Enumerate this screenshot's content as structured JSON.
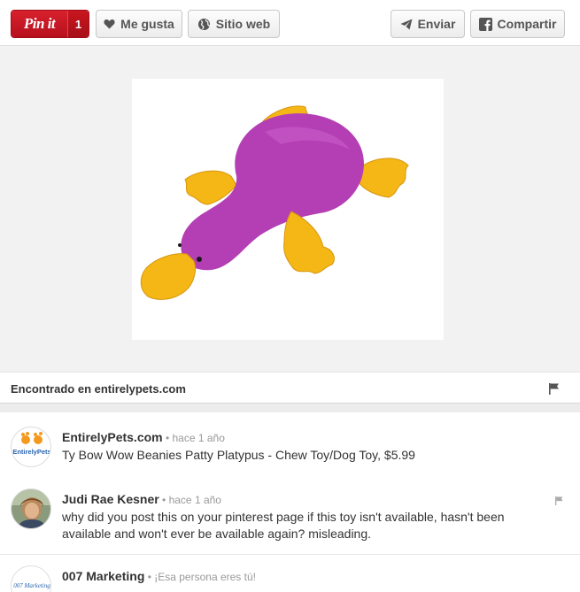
{
  "toolbar": {
    "pinit_label": "Pin it",
    "pin_count": "1",
    "like_label": "Me gusta",
    "website_label": "Sitio web",
    "send_label": "Enviar",
    "share_label": "Compartir"
  },
  "product": {
    "image_icon": "purple-platypus-plush-toy"
  },
  "found_on": {
    "text": "Encontrado en entirelypets.com"
  },
  "comments": [
    {
      "author": "EntirelyPets.com",
      "time": " • hace 1 año",
      "text": "Ty Bow Wow Beanies Patty Platypus - Chew Toy/Dog Toy, $5.99",
      "avatar_text": "EntirelyPets"
    },
    {
      "author": "Judi Rae Kesner",
      "time": " • hace 1 año",
      "text": "why did you post this on your pinterest page if this toy isn't available, hasn't been available and won't ever be available again? misleading."
    },
    {
      "author": "007 Marketing",
      "time": " • ¡Esa persona eres tú!",
      "text": "",
      "avatar_text": "007 Marketing"
    }
  ],
  "colors": {
    "pin_red": "#c8151f",
    "toy_purple": "#b43fb5",
    "toy_yellow": "#f4b716"
  }
}
